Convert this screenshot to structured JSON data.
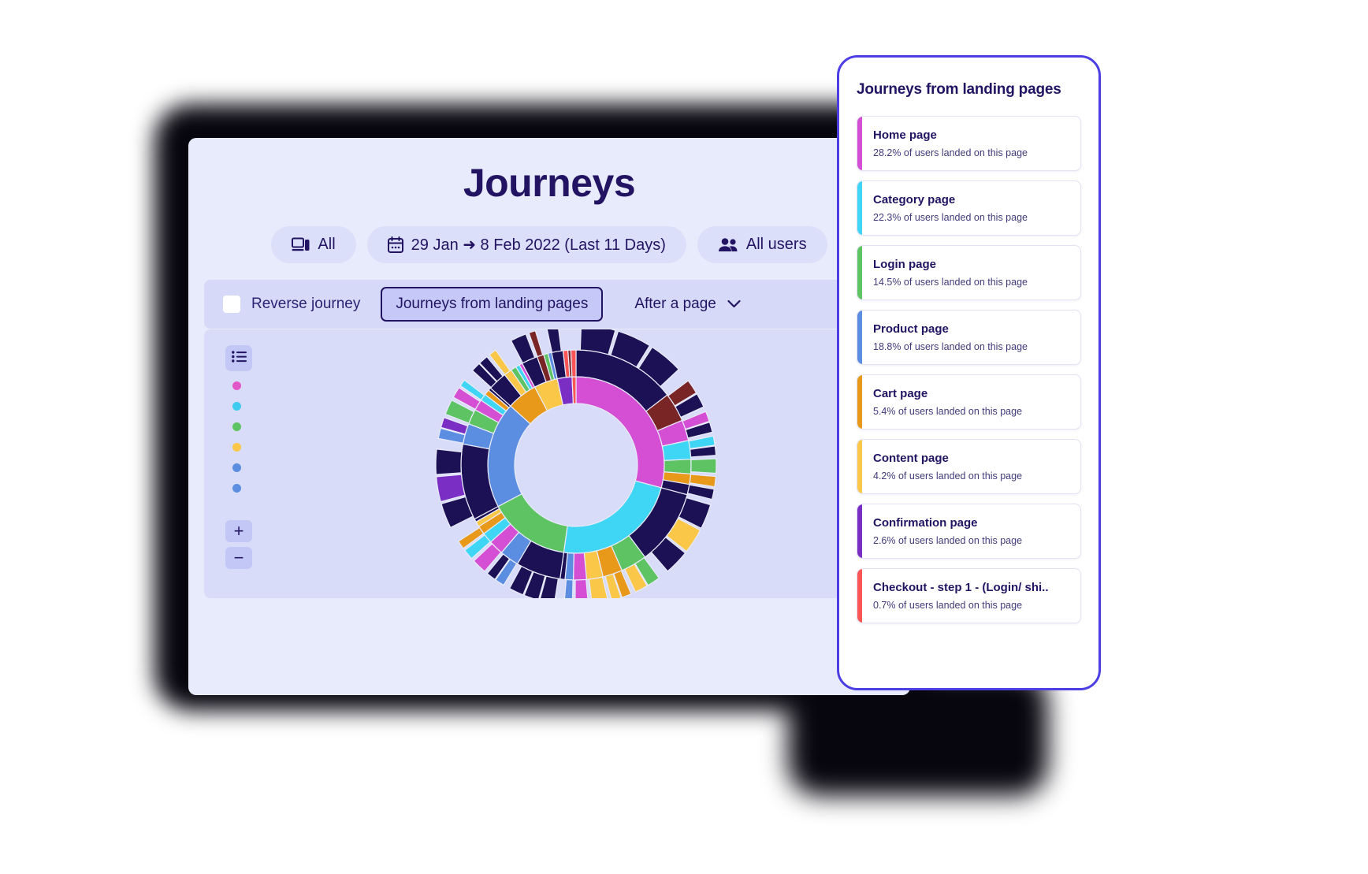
{
  "app": {
    "title": "Journeys",
    "filters": [
      {
        "icon": "device-icon",
        "label": "All"
      },
      {
        "icon": "calendar-icon",
        "label": "29 Jan ➜ 8 Feb 2022 (Last 11 Days)"
      },
      {
        "icon": "users-icon",
        "label": "All users"
      }
    ],
    "options_bar": {
      "reverse_journey_label": "Reverse journey",
      "reverse_journey_checked": false,
      "active_tab": "Journeys from landing pages",
      "dropdown": {
        "label": "After a page",
        "icon": "chevron-down-icon"
      }
    },
    "chart_toolbar": {
      "list_icon": "list-icon",
      "zoom_in": "+",
      "zoom_out": "−",
      "legend_colors": [
        "#e356c8",
        "#3ecdf0",
        "#5ec463",
        "#fbc748",
        "#5b8ee0",
        "#5b8ee0"
      ]
    }
  },
  "phone": {
    "title": "Journeys from landing pages",
    "items": [
      {
        "name": "Home page",
        "sub": "28.2% of users landed on this page",
        "color": "#d44fd4"
      },
      {
        "name": "Category page",
        "sub": "22.3% of users landed on this page",
        "color": "#3fd5f5"
      },
      {
        "name": "Login page",
        "sub": "14.5% of users landed on this page",
        "color": "#5ec463"
      },
      {
        "name": "Product page",
        "sub": "18.8% of users landed on this page",
        "color": "#5b8ee0"
      },
      {
        "name": "Cart page",
        "sub": "5.4% of users landed on this page",
        "color": "#e8991a"
      },
      {
        "name": "Content page",
        "sub": "4.2% of users landed on this page",
        "color": "#fbc748"
      },
      {
        "name": "Confirmation page",
        "sub": "2.6% of users landed on this page",
        "color": "#7b2ec4"
      },
      {
        "name": "Checkout - step 1 - (Login/ shi..",
        "sub": "0.7% of users landed on this page",
        "color": "#fc5555"
      }
    ]
  },
  "chart_data": {
    "type": "pie",
    "title": "Journeys from landing pages",
    "subtype": "sunburst",
    "rings": 3,
    "inner_ring": {
      "labels": [
        "Home page",
        "Category page",
        "Login page",
        "Product page",
        "Cart page",
        "Content page",
        "Confirmation page",
        "Checkout - step 1 - (Login/ shi.."
      ],
      "values": [
        28.2,
        22.3,
        14.5,
        18.8,
        5.4,
        4.2,
        2.6,
        0.7
      ],
      "colors": [
        "#d44fd4",
        "#3fd5f5",
        "#5ec463",
        "#5b8ee0",
        "#e8991a",
        "#fbc748",
        "#7b2ec4",
        "#fc5555"
      ]
    },
    "legend_position": "left",
    "grid": false,
    "xlabel": "",
    "ylabel": ""
  }
}
